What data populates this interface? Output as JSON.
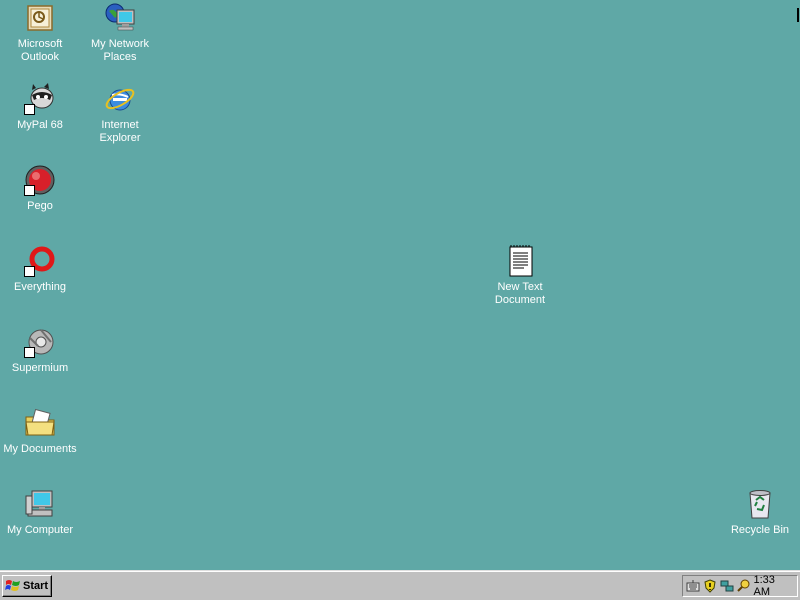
{
  "desktop": {
    "icons": [
      {
        "label": "Microsoft\nOutlook",
        "icon": "outlook-icon"
      },
      {
        "label": "My Network\nPlaces",
        "icon": "network-places-icon"
      },
      {
        "label": "MyPal 68",
        "icon": "mypal-icon"
      },
      {
        "label": "Internet\nExplorer",
        "icon": "internet-explorer-icon"
      },
      {
        "label": "Pego",
        "icon": "pego-icon"
      },
      {
        "label": "Everything",
        "icon": "everything-icon"
      },
      {
        "label": "Supermium",
        "icon": "supermium-icon"
      },
      {
        "label": "My Documents",
        "icon": "my-documents-icon"
      },
      {
        "label": "My Computer",
        "icon": "my-computer-icon"
      },
      {
        "label": "New Text\nDocument",
        "icon": "text-document-icon"
      },
      {
        "label": "Recycle Bin",
        "icon": "recycle-bin-icon"
      }
    ]
  },
  "taskbar": {
    "start_label": "Start",
    "tray_icons": [
      "keyboard-icon",
      "security-shield-icon",
      "network-icon",
      "search-key-icon"
    ],
    "clock": "1:33 AM"
  },
  "colors": {
    "desktop_background": "#5fa8a6",
    "taskbar": "#c0c0c0"
  }
}
